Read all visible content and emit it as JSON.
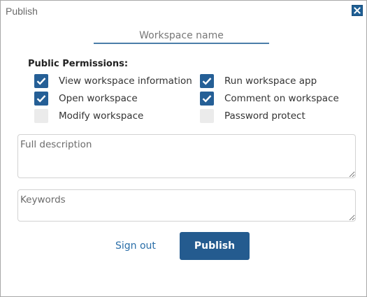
{
  "window": {
    "title": "Publish",
    "close_icon": "close-icon"
  },
  "workspace_name": {
    "placeholder": "Workspace name",
    "value": ""
  },
  "permissions": {
    "heading": "Public Permissions:",
    "left": [
      {
        "label": "View workspace information",
        "checked": true
      },
      {
        "label": "Open workspace",
        "checked": true
      },
      {
        "label": "Modify workspace",
        "checked": false
      }
    ],
    "right": [
      {
        "label": "Run workspace app",
        "checked": true
      },
      {
        "label": "Comment on workspace",
        "checked": true
      },
      {
        "label": "Password protect",
        "checked": false
      }
    ]
  },
  "description": {
    "placeholder": "Full description",
    "value": ""
  },
  "keywords": {
    "placeholder": "Keywords",
    "value": ""
  },
  "actions": {
    "sign_out_label": "Sign out",
    "publish_label": "Publish"
  },
  "colors": {
    "accent": "#245b8f",
    "checkbox_checked": "#255f96",
    "checkbox_unchecked": "#ebebeb",
    "link": "#2a6ea8"
  }
}
